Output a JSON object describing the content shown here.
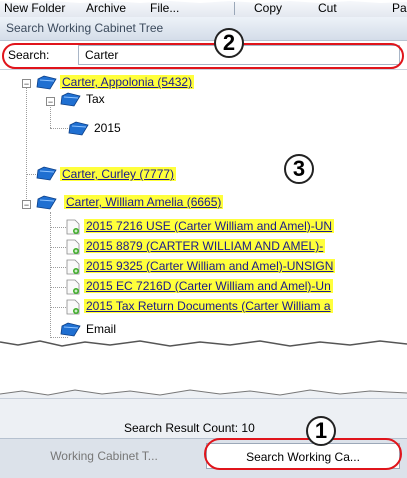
{
  "toolbar": {
    "items": [
      "New Folder",
      "Archive",
      "File...",
      "Copy",
      "Cut",
      "Pa"
    ]
  },
  "panel": {
    "title": "Search Working Cabinet Tree"
  },
  "search": {
    "label": "Search:",
    "value": "Carter"
  },
  "tree": {
    "nodes": [
      {
        "label": "Carter, Appolonia (5432)"
      },
      {
        "label": "Tax"
      },
      {
        "label": "2015"
      },
      {
        "label": "Carter, Curley (7777)"
      },
      {
        "label": "Carter, William  Amelia (6665)"
      },
      {
        "label": "2015 7216  USE (Carter William and Amel)-UN"
      },
      {
        "label": "2015 8879 (CARTER WILLIAM AND AMEL)-"
      },
      {
        "label": "2015 9325 (Carter William and Amel)-UNSIGN"
      },
      {
        "label": "2015 EC  7216D (Carter William and Amel)-Un"
      },
      {
        "label": "2015 Tax Return Documents (Carter William a"
      },
      {
        "label": "Email"
      }
    ]
  },
  "status": {
    "result_count": "Search Result Count: 10"
  },
  "tabs": [
    {
      "label": "Working Cabinet T..."
    },
    {
      "label": "Search Working Ca..."
    }
  ],
  "callouts": [
    "1",
    "2",
    "3"
  ],
  "colors": {
    "highlight": "#ffff3b",
    "annotation_ring": "#e0141b",
    "folder_blue": "#1f6fd1"
  }
}
